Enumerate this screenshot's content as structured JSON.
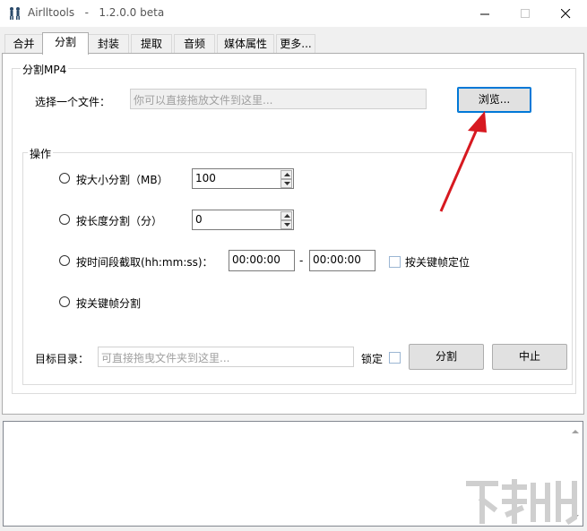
{
  "window": {
    "title": "Airlltools   -   1.2.0.0 beta"
  },
  "tabs": [
    {
      "label": "合并"
    },
    {
      "label": "分割"
    },
    {
      "label": "封装"
    },
    {
      "label": "提取"
    },
    {
      "label": "音频"
    },
    {
      "label": "媒体属性"
    },
    {
      "label": "更多..."
    }
  ],
  "split_group": {
    "legend": "分割MP4",
    "file_label": "选择一个文件：",
    "file_placeholder": "你可以直接拖放文件到这里...",
    "browse_label": "浏览..."
  },
  "operation_group": {
    "legend": "操作",
    "options": [
      {
        "label": "按大小分割（MB）",
        "value": "100"
      },
      {
        "label": "按长度分割（分）",
        "value": "0"
      },
      {
        "label": "按时间段截取(hh:mm:ss)：",
        "start": "00:00:00",
        "separator": "-",
        "end": "00:00:00",
        "check_label": "按关键帧定位"
      },
      {
        "label": "按关键帧分割"
      }
    ]
  },
  "target": {
    "label": "目标目录：",
    "placeholder": "可直接拖曳文件夹到这里...",
    "lock_label": "锁定",
    "split_button": "分割",
    "stop_button": "中止"
  },
  "colors": {
    "accent": "#0078d7",
    "arrow": "#d71920"
  }
}
